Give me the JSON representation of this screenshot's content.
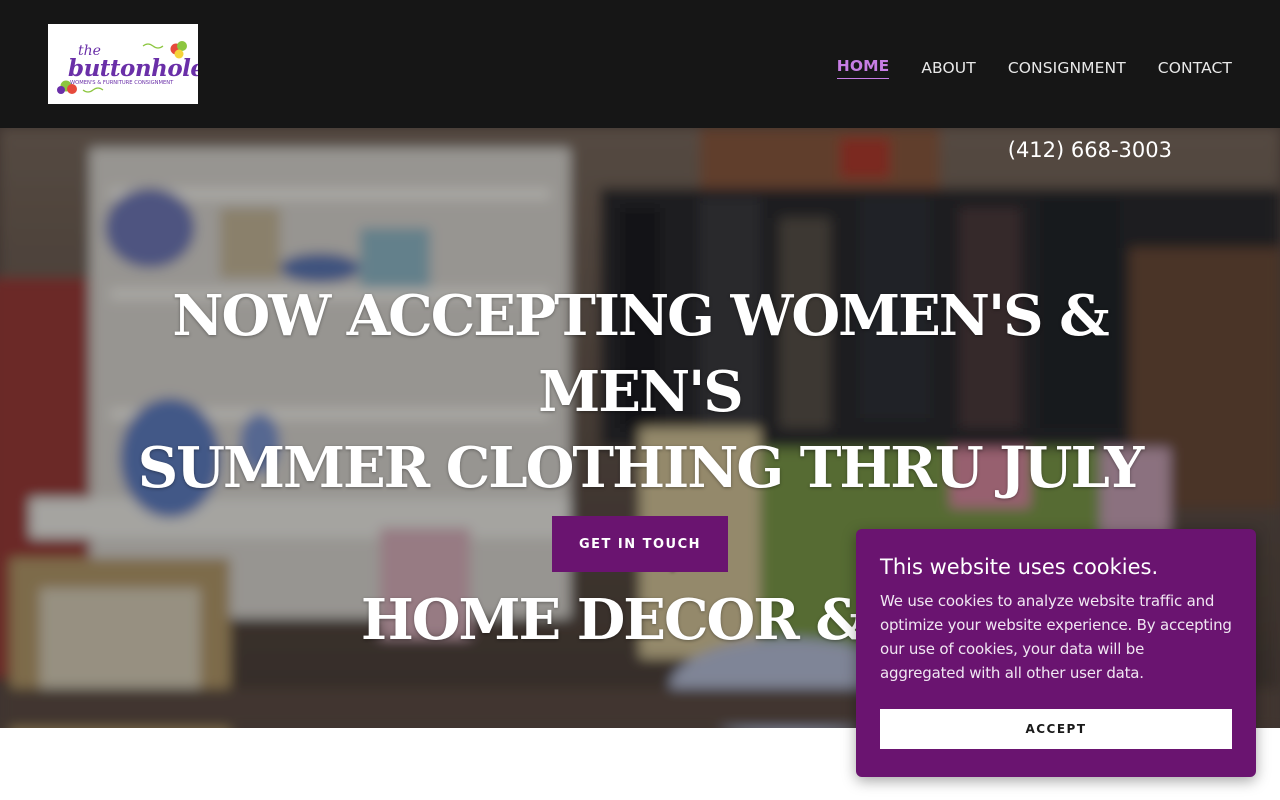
{
  "header": {
    "logo": {
      "text_top": "the",
      "text_main": "buttonhole",
      "tagline": "WOMEN'S & FURNITURE CONSIGNMENT"
    },
    "nav": [
      {
        "label": "HOME",
        "active": true
      },
      {
        "label": "ABOUT",
        "active": false
      },
      {
        "label": "CONSIGNMENT",
        "active": false
      },
      {
        "label": "CONTACT",
        "active": false
      }
    ]
  },
  "hero": {
    "phone": "(412) 668-3003",
    "headline_lines": [
      "NOW ACCEPTING WOMEN'S & MEN'S",
      "SUMMER CLOTHING THRU JULY 31,",
      "HOME DECOR & F"
    ],
    "cta_label": "GET IN TOUCH"
  },
  "cookie_banner": {
    "title": "This website uses cookies.",
    "text": "We use cookies to analyze website traffic and optimize your website experience. By accepting our use of cookies, your data will be aggregated with all other user data.",
    "accept_label": "ACCEPT"
  },
  "colors": {
    "header_bg": "#161616",
    "accent": "#6a1470",
    "nav_active": "#c77de4",
    "logo_purple": "#6a2fa8"
  }
}
